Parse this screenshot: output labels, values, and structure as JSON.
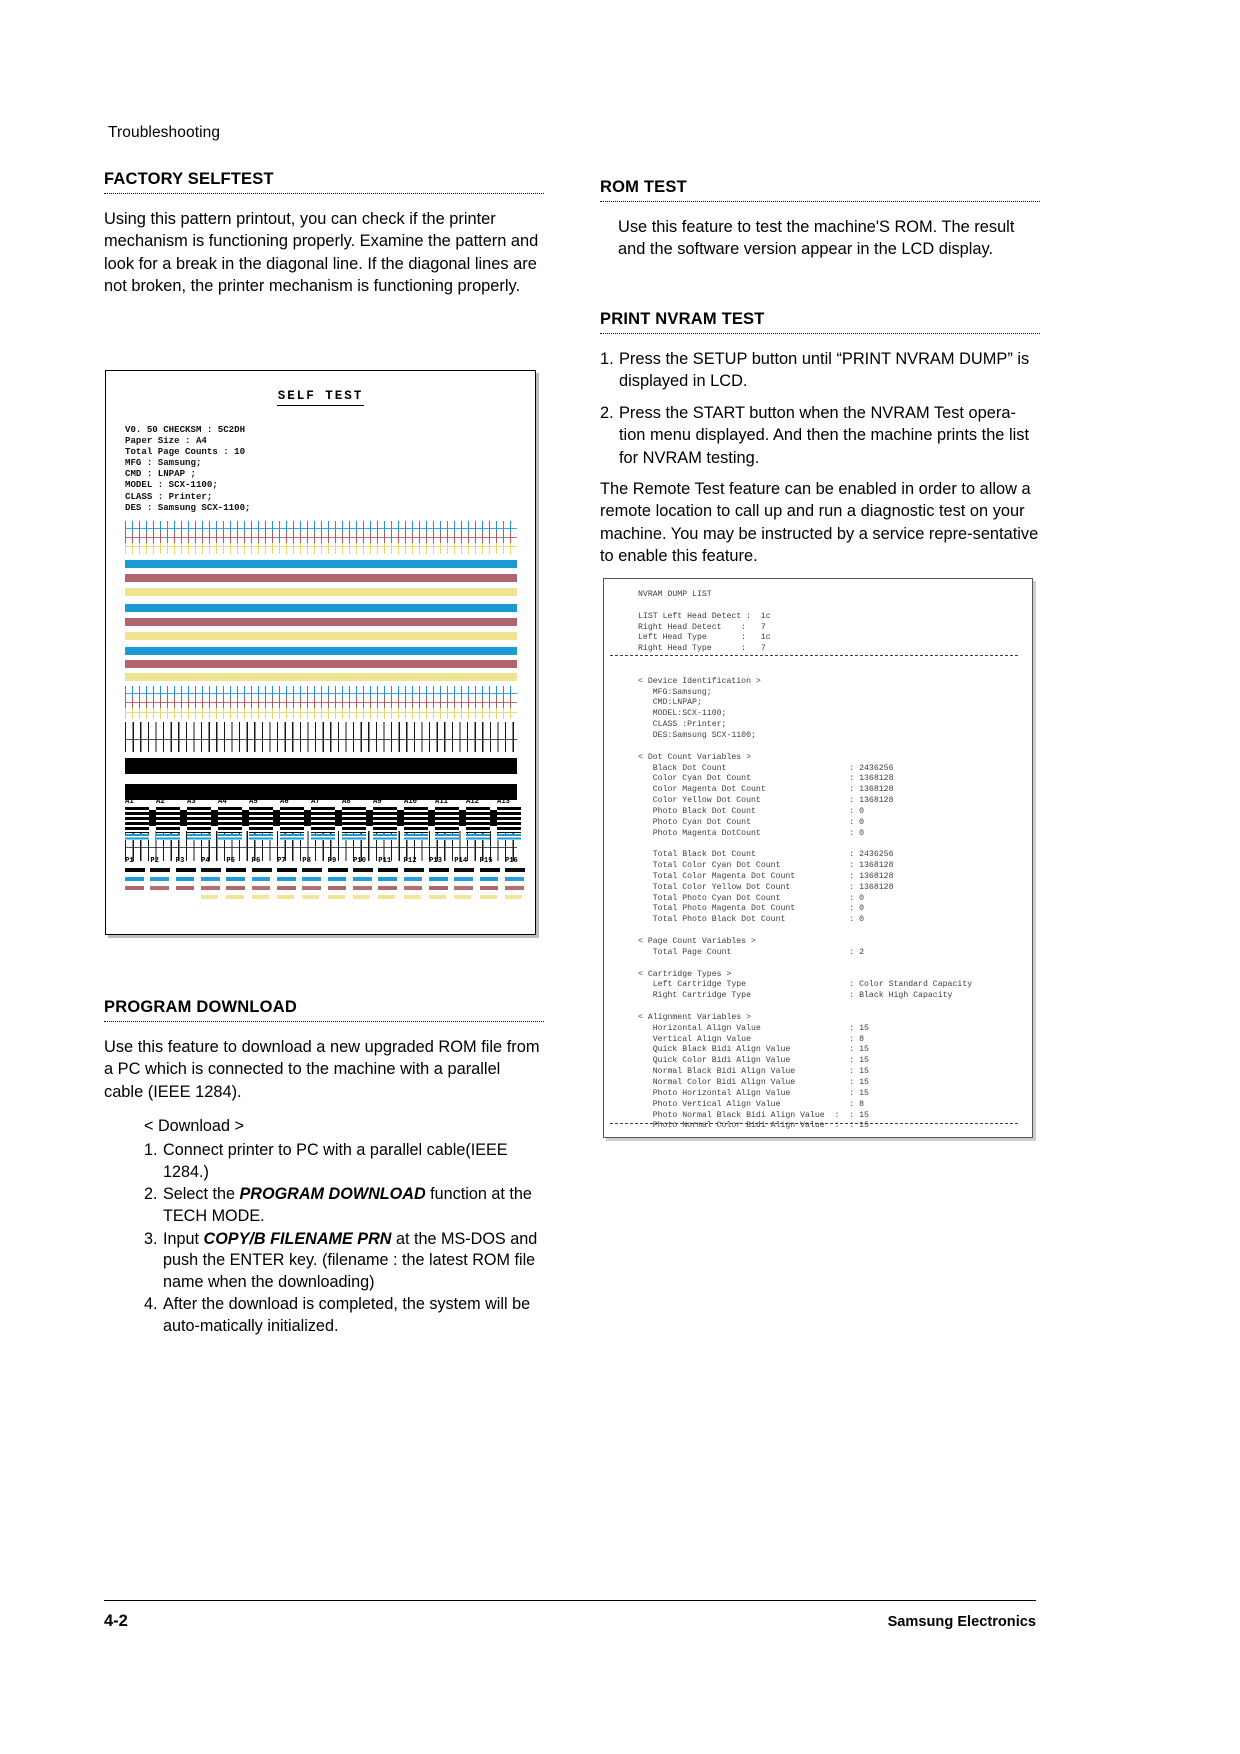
{
  "page": {
    "running_head": "Troubleshooting",
    "footer_page_number": "4-2",
    "footer_brand": "Samsung Electronics"
  },
  "left_column": {
    "factory_selftest": {
      "heading": "FACTORY SELFTEST",
      "paragraph": "Using this pattern printout, you can check if the printer mechanism is functioning properly. Examine the pattern and look for a break in the diagonal line. If the diagonal lines are not broken, the printer mechanism is functioning properly."
    },
    "program_download": {
      "heading": "PROGRAM  DOWNLOAD",
      "paragraph": "Use this feature to download a new upgraded ROM file from a PC which is connected to the machine with a parallel cable (IEEE 1284).",
      "sub_heading": "< Download >",
      "steps": [
        {
          "num": "1.",
          "parts": [
            {
              "text": "Connect printer to PC with a parallel cable(IEEE 1284.)",
              "style": "normal"
            }
          ]
        },
        {
          "num": "2.",
          "parts": [
            {
              "text": "Select the ",
              "style": "normal"
            },
            {
              "text": "PROGRAM DOWNLOAD",
              "style": "bold-italic"
            },
            {
              "text": "  function at the TECH MODE.",
              "style": "normal"
            }
          ]
        },
        {
          "num": "3.",
          "parts": [
            {
              "text": "Input ",
              "style": "normal"
            },
            {
              "text": "COPY/B FILENAME PRN",
              "style": "bold-italic"
            },
            {
              "text": " at the MS-DOS and push the ENTER key.",
              "style": "normal"
            },
            {
              "text": "\n(filename : the latest ROM file name when the downloading)",
              "style": "normal"
            }
          ]
        },
        {
          "num": "4.",
          "parts": [
            {
              "text": "After the download is completed, the system will be auto-matically initialized.",
              "style": "normal"
            }
          ]
        }
      ]
    }
  },
  "right_column": {
    "rom_test": {
      "heading": "ROM TEST",
      "paragraph": "Use this feature to test the machine'S ROM. The result and the software version appear in the LCD display."
    },
    "print_nvram_test": {
      "heading": "PRINT NVRAM TEST",
      "steps": [
        {
          "num": "1.",
          "text": "Press the SETUP button until “PRINT NVRAM DUMP” is displayed in LCD."
        },
        {
          "num": "2.",
          "text": "Press the START button when the NVRAM Test opera-tion menu displayed. And then the machine prints the list for NVRAM testing."
        }
      ],
      "trailing_paragraph": "The Remote Test feature can be enabled in order to allow a remote location to call up and run a diagnostic test on your machine. You may be instructed by a service repre-sentative to enable this feature."
    }
  },
  "selftest_figure": {
    "title": "SELF  TEST",
    "info_lines": "V0. 50 CHECKSM : 5C2DH\nPaper Size : A4\nTotal Page Counts : 10\nMFG : Samsung;\nCMD : LNPAP ;\nMODEL : SCX-1100;\nCLASS : Printer;\nDES : Samsung SCX-1100;",
    "a_labels": [
      "A1",
      "A2",
      "A3",
      "A4",
      "A5",
      "A6",
      "A7",
      "A8",
      "A9",
      "A10",
      "A11",
      "A12",
      "A13"
    ],
    "p_labels": [
      "P1",
      "P2",
      "P3",
      "P4",
      "P5",
      "P6",
      "P7",
      "P8",
      "P9",
      "P10",
      "P11",
      "P12",
      "P13",
      "P14",
      "P15",
      "P16"
    ],
    "colors": {
      "cyan": "#1b9ad6",
      "magenta": "#b0666d",
      "yellow": "#f0e493",
      "black": "#000000"
    }
  },
  "nvram_figure": {
    "title": "NVRAM DUMP LIST",
    "head_block": [
      {
        "label": "LIST Left Head Detect :",
        "value": "1c"
      },
      {
        "label": "Right Head Detect    :",
        "value": "7"
      },
      {
        "label": "Left Head Type       :",
        "value": "1c"
      },
      {
        "label": "Right Head Type      :",
        "value": "7"
      }
    ],
    "sections": [
      {
        "title": "< Device Identification >",
        "lines": [
          "MFG:Samsung;",
          "CMD:LNPAP;",
          "MODEL:SCX-1100;",
          "CLASS :Printer;",
          "DES:Samsung SCX-1100;"
        ]
      },
      {
        "title": "< Dot Count Variables >",
        "rows": [
          {
            "label": "Black Dot Count",
            "value": "2436256"
          },
          {
            "label": "Color Cyan Dot Count",
            "value": "1368128"
          },
          {
            "label": "Color Magenta Dot Count",
            "value": "1368128"
          },
          {
            "label": "Color Yellow Dot Count",
            "value": "1368128"
          },
          {
            "label": "Photo Black Dot Count",
            "value": "0"
          },
          {
            "label": "Photo Cyan Dot Count",
            "value": "0"
          },
          {
            "label": "Photo Magenta DotCount",
            "value": "0"
          },
          {
            "label": "",
            "value": ""
          },
          {
            "label": "Total Black Dot Count",
            "value": "2436256"
          },
          {
            "label": "Total Color Cyan Dot Count",
            "value": "1368128"
          },
          {
            "label": "Total Color Magenta Dot Count",
            "value": "1368128"
          },
          {
            "label": "Total Color Yellow Dot Count",
            "value": "1368128"
          },
          {
            "label": "Total Photo Cyan Dot Count",
            "value": "0"
          },
          {
            "label": "Total Photo Magenta Dot Count",
            "value": "0"
          },
          {
            "label": "Total Photo Black Dot Count",
            "value": "0"
          }
        ]
      },
      {
        "title": "< Page Count Variables >",
        "rows": [
          {
            "label": "Total Page Count",
            "value": "2"
          }
        ]
      },
      {
        "title": "< Cartridge Types >",
        "rows": [
          {
            "label": "Left Cartridge Type",
            "value": "Color Standard Capacity"
          },
          {
            "label": "Right Cartridge Type",
            "value": "Black High Capacity"
          }
        ]
      },
      {
        "title": "< Alignment Variables >",
        "rows": [
          {
            "label": "Horizontal Align Value",
            "value": "15"
          },
          {
            "label": "Vertical Align Value",
            "value": "8"
          },
          {
            "label": "Quick Black Bidi Align Value",
            "value": "15"
          },
          {
            "label": "Quick Color Bidi Align Value",
            "value": "15"
          },
          {
            "label": "Normal Black Bidi Align Value",
            "value": "15"
          },
          {
            "label": "Normal Color Bidi Align Value",
            "value": "15"
          },
          {
            "label": "Photo Horizontal Align Value",
            "value": "15"
          },
          {
            "label": "Photo Vertical Align Value",
            "value": "8"
          },
          {
            "label": "Photo Normal Black Bidi Align Value  :",
            "value": "15"
          },
          {
            "label": "Photo Normal Color Bidi Align Value  :",
            "value": "15"
          }
        ]
      }
    ]
  }
}
